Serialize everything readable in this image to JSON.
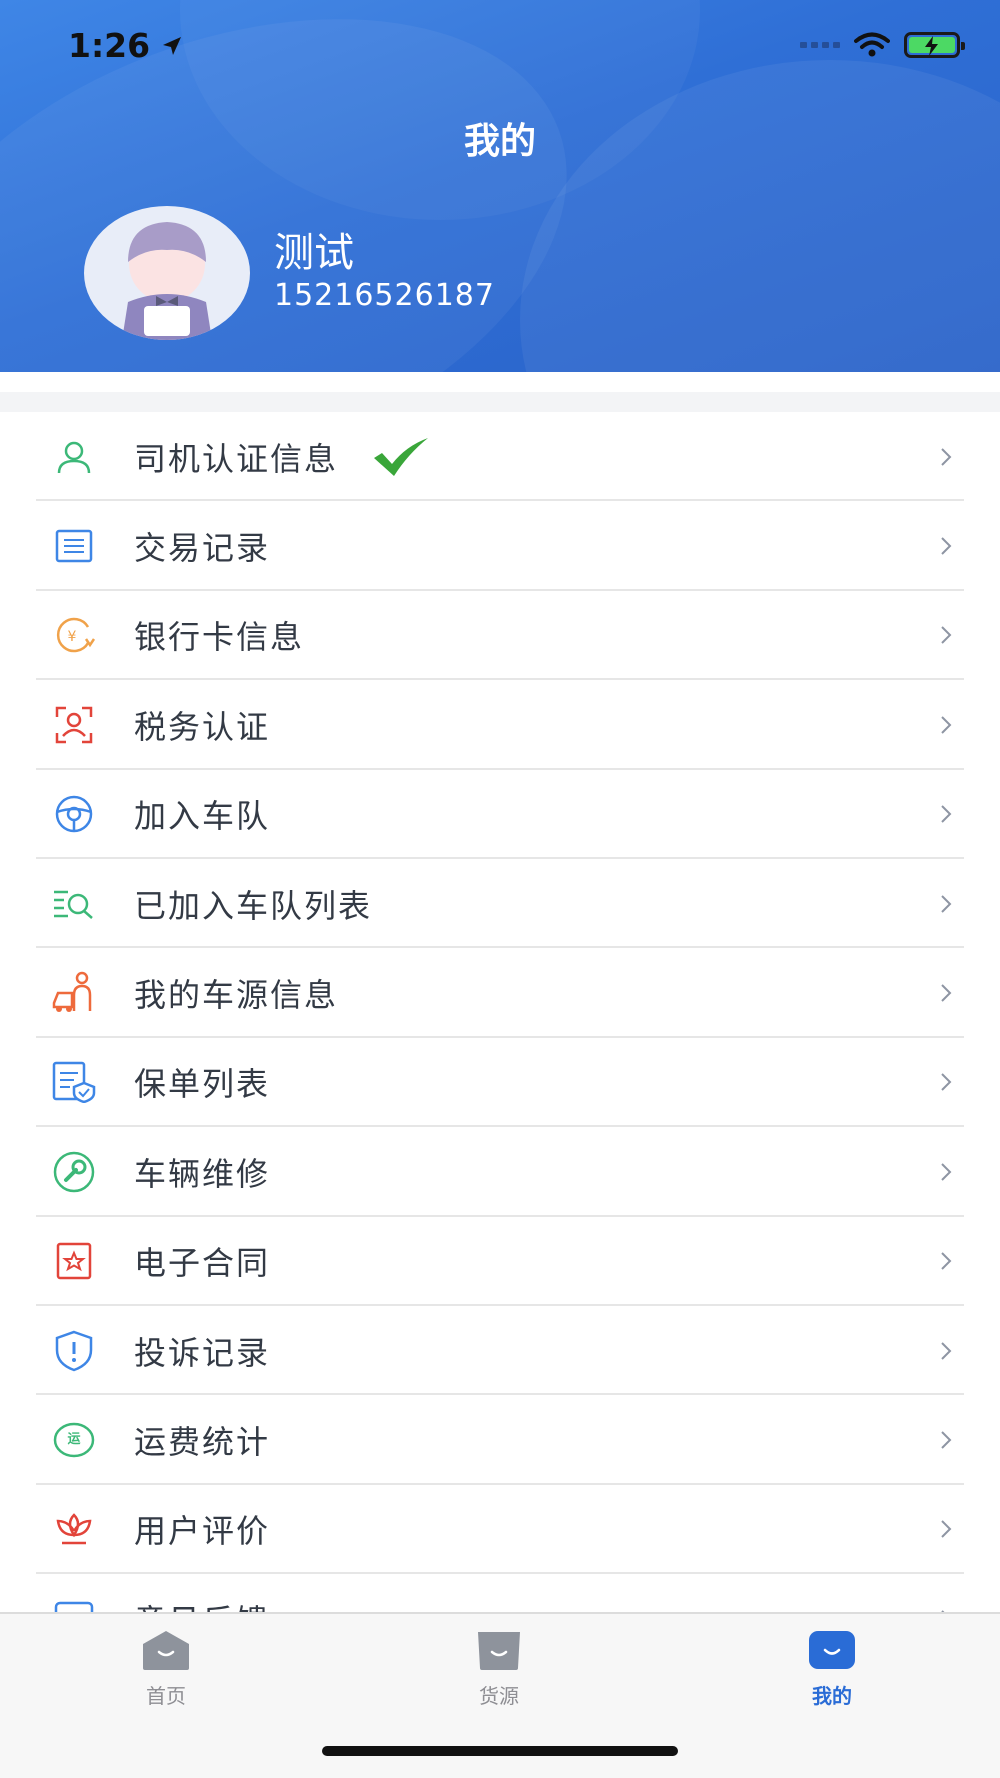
{
  "status_bar": {
    "time": "1:26"
  },
  "header": {
    "title": "我的",
    "user_name": "测试",
    "user_phone": "15216526187"
  },
  "menu": {
    "items": [
      {
        "label": "司机认证信息",
        "icon": "user-icon",
        "color": "#3cb878",
        "verified": true
      },
      {
        "label": "交易记录",
        "icon": "list-icon",
        "color": "#3e86e6"
      },
      {
        "label": "银行卡信息",
        "icon": "yen-coin-icon",
        "color": "#f0a24a"
      },
      {
        "label": "税务认证",
        "icon": "face-scan-icon",
        "color": "#e2443a"
      },
      {
        "label": "加入车队",
        "icon": "steering-wheel-icon",
        "color": "#3e86e6"
      },
      {
        "label": "已加入车队列表",
        "icon": "search-list-icon",
        "color": "#3cb878"
      },
      {
        "label": "我的车源信息",
        "icon": "person-car-icon",
        "color": "#ee6a3c"
      },
      {
        "label": "保单列表",
        "icon": "policy-shield-icon",
        "color": "#3e86e6"
      },
      {
        "label": "车辆维修",
        "icon": "wrench-icon",
        "color": "#3cb878"
      },
      {
        "label": "电子合同",
        "icon": "contract-star-icon",
        "color": "#e2443a"
      },
      {
        "label": "投诉记录",
        "icon": "shield-alert-icon",
        "color": "#3e86e6"
      },
      {
        "label": "运费统计",
        "icon": "freight-badge-icon",
        "color": "#3cb878"
      },
      {
        "label": "用户评价",
        "icon": "lotus-icon",
        "color": "#e2443a"
      },
      {
        "label": "意见反馈",
        "icon": "feedback-icon",
        "color": "#3e86e6"
      }
    ],
    "freight_badge_text": "运"
  },
  "tabbar": {
    "tabs": [
      {
        "label": "首页",
        "active": false
      },
      {
        "label": "货源",
        "active": false
      },
      {
        "label": "我的",
        "active": true
      }
    ]
  },
  "colors": {
    "primary": "#2f6fd6",
    "active_tab": "#2a6cd6",
    "inactive_tab": "#8e8e93"
  }
}
